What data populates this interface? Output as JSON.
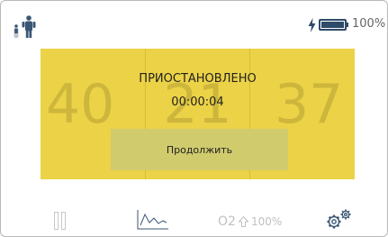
{
  "status_bar": {
    "profile_icon": "adult-child-icon",
    "charging_icon": "bolt-icon",
    "battery_percent": "100%",
    "battery_level": 1.0
  },
  "paused_panel": {
    "metrics": [
      {
        "value": "40"
      },
      {
        "value": "21"
      },
      {
        "value": "37"
      }
    ],
    "status_title": "ПРИОСТАНОВЛЕНО",
    "timer": "00:00:04",
    "continue_label": "Продолжить",
    "background_color": "#ebd247"
  },
  "bottom_bar": {
    "pause_icon": "pause-icon",
    "chart_icon": "trend-chart-icon",
    "o2_label": "O2",
    "o2_arrow_icon": "arrow-up-icon",
    "o2_percent": "100%",
    "settings_icon": "gears-icon"
  }
}
